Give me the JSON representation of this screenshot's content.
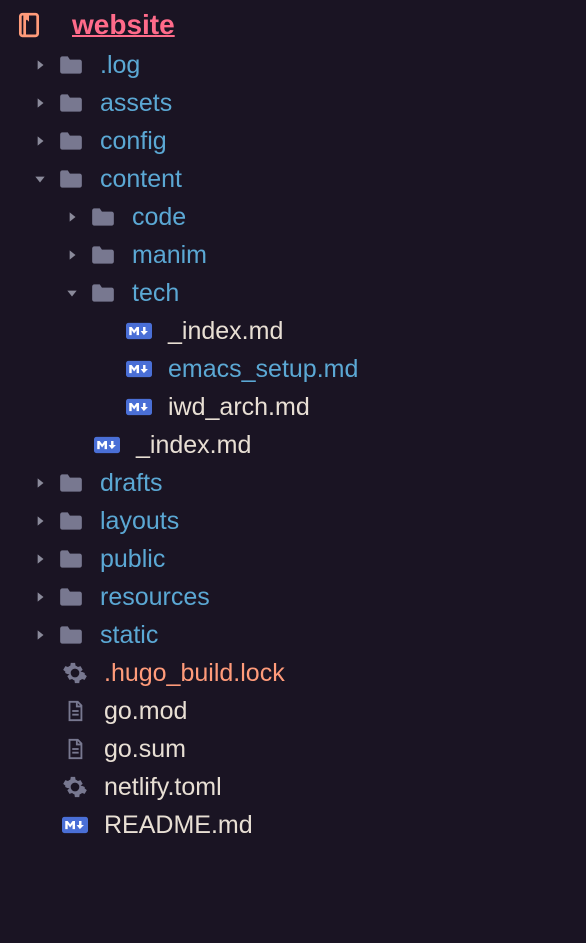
{
  "root": {
    "label": "website"
  },
  "items": [
    {
      "type": "folder",
      "depth": 0,
      "expanded": false,
      "label": ".log"
    },
    {
      "type": "folder",
      "depth": 0,
      "expanded": false,
      "label": "assets"
    },
    {
      "type": "folder",
      "depth": 0,
      "expanded": false,
      "label": "config"
    },
    {
      "type": "folder",
      "depth": 0,
      "expanded": true,
      "label": "content"
    },
    {
      "type": "folder",
      "depth": 1,
      "expanded": false,
      "label": "code"
    },
    {
      "type": "folder",
      "depth": 1,
      "expanded": false,
      "label": "manim"
    },
    {
      "type": "folder",
      "depth": 1,
      "expanded": true,
      "label": "tech"
    },
    {
      "type": "file",
      "depth": 2,
      "icon": "md",
      "style": "normal",
      "label": "_index.md"
    },
    {
      "type": "file",
      "depth": 2,
      "icon": "md",
      "style": "highlight",
      "label": "emacs_setup.md"
    },
    {
      "type": "file",
      "depth": 2,
      "icon": "md",
      "style": "normal",
      "label": "iwd_arch.md"
    },
    {
      "type": "file",
      "depth": 1,
      "icon": "md",
      "style": "normal",
      "label": "_index.md"
    },
    {
      "type": "folder",
      "depth": 0,
      "expanded": false,
      "label": "drafts"
    },
    {
      "type": "folder",
      "depth": 0,
      "expanded": false,
      "label": "layouts"
    },
    {
      "type": "folder",
      "depth": 0,
      "expanded": false,
      "label": "public"
    },
    {
      "type": "folder",
      "depth": 0,
      "expanded": false,
      "label": "resources"
    },
    {
      "type": "folder",
      "depth": 0,
      "expanded": false,
      "label": "static"
    },
    {
      "type": "file",
      "depth": 0,
      "icon": "gear",
      "style": "special",
      "label": ".hugo_build.lock"
    },
    {
      "type": "file",
      "depth": 0,
      "icon": "doc",
      "style": "normal",
      "label": "go.mod"
    },
    {
      "type": "file",
      "depth": 0,
      "icon": "doc",
      "style": "normal",
      "label": "go.sum"
    },
    {
      "type": "file",
      "depth": 0,
      "icon": "gear",
      "style": "normal",
      "label": "netlify.toml"
    },
    {
      "type": "file",
      "depth": 0,
      "icon": "md",
      "style": "normal",
      "label": "README.md"
    }
  ]
}
